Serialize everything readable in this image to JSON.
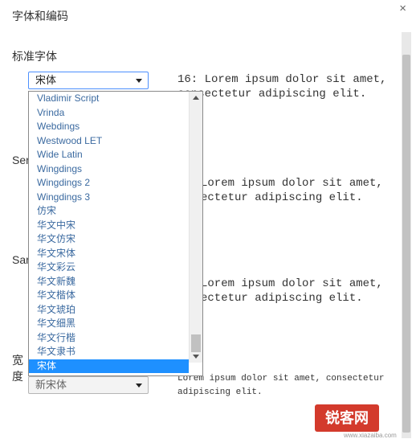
{
  "dialog": {
    "title": "字体和编码",
    "close_glyph": "×"
  },
  "sections": {
    "standard_title": "标准字体",
    "serif_label": "Ser",
    "sans_label": "Sar",
    "width_label": "宽度"
  },
  "selects": {
    "standard_value": "宋体",
    "fixed_value": "新宋体"
  },
  "previews": {
    "standard_line1": "16: Lorem ipsum dolor sit amet,",
    "standard_line2": "consectetur adipiscing elit.",
    "serif_line1": "Lorem ipsum dolor sit amet,",
    "serif_line2": "ectetur adipiscing elit.",
    "sans_line1": "Lorem ipsum dolor sit amet,",
    "sans_line2": "ectetur adipiscing elit.",
    "fixed_line1": "Lorem ipsum dolor sit amet, consectetur",
    "fixed_line2": "adipiscing elit."
  },
  "dropdown": {
    "options": [
      "Vladimir Script",
      "Vrinda",
      "Webdings",
      "Westwood LET",
      "Wide Latin",
      "Wingdings",
      "Wingdings 2",
      "Wingdings 3",
      "仿宋",
      "华文中宋",
      "华文仿宋",
      "华文宋体",
      "华文彩云",
      "华文新魏",
      "华文楷体",
      "华文琥珀",
      "华文细黑",
      "华文行楷",
      "华文隶书",
      "宋体"
    ],
    "selected_index": 19
  },
  "watermark": {
    "logo_text": "锐客网",
    "url_text": "www.xiazaiba.com"
  },
  "colors": {
    "selection": "#1e90ff",
    "option_text": "#3b6aa0",
    "watermark": "#d33a2c"
  }
}
